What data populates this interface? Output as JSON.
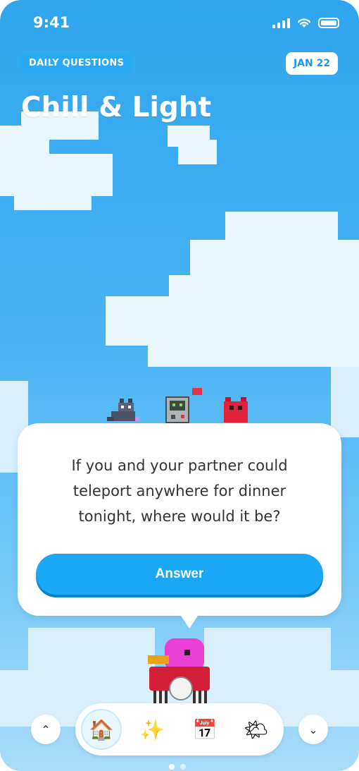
{
  "status": {
    "time": "9:41"
  },
  "header": {
    "tag": "DAILY QUESTIONS",
    "date": "JAN 22",
    "title": "Chill & Light"
  },
  "card": {
    "question": "If you and your partner could teleport anywhere for dinner tonight, where would it be?",
    "answer_label": "Answer"
  },
  "nav": {
    "up_glyph": "⌃",
    "down_glyph": "⌄",
    "tabs": [
      {
        "icon": "house-icon",
        "glyph": "🏠"
      },
      {
        "icon": "sparkles-icon",
        "glyph": "✨"
      },
      {
        "icon": "calendar-icon",
        "glyph": "📅"
      },
      {
        "icon": "sun-cloud-icon",
        "glyph": "🌤"
      }
    ]
  },
  "colors": {
    "sky": "#2fa5ee",
    "accent": "#1aa7f5",
    "tag_bg": "#29a8f3",
    "date_text": "#1e98e8"
  }
}
